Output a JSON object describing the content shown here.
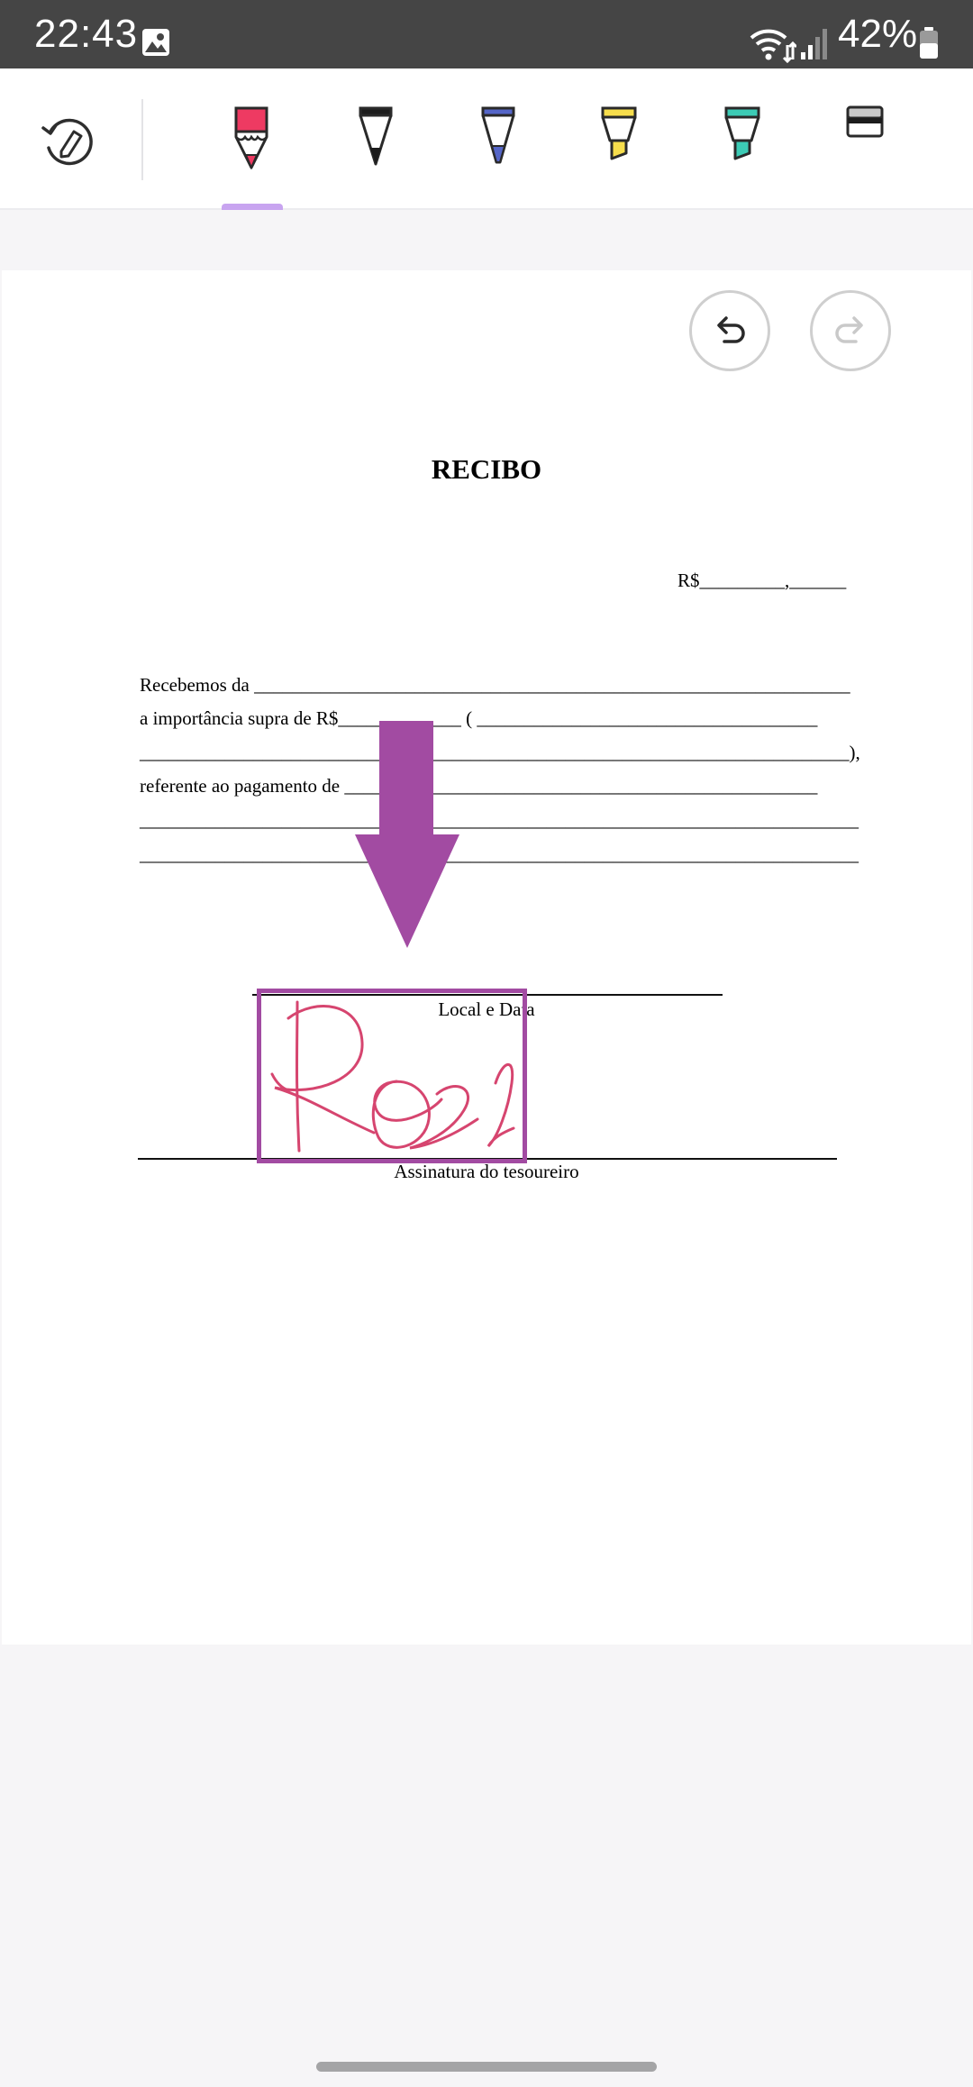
{
  "status_bar": {
    "time": "22:43",
    "battery_percent": "42%",
    "icons": [
      "gallery-icon",
      "wifi-icon",
      "signal-icon",
      "battery-icon"
    ]
  },
  "toolbar": {
    "tools": [
      {
        "name": "history-eraser-icon"
      },
      {
        "name": "pen-red-icon",
        "color": "#ee3a62",
        "selected": true
      },
      {
        "name": "pen-black-icon",
        "color": "#1c1c1c"
      },
      {
        "name": "pen-blue-icon",
        "color": "#5566c8"
      },
      {
        "name": "marker-yellow-icon",
        "color": "#f7de4c"
      },
      {
        "name": "marker-teal-icon",
        "color": "#3ccbb5"
      },
      {
        "name": "eraser-icon",
        "color": "#c9c9c9"
      }
    ],
    "selected_indicator_color": "#c8a4f0"
  },
  "document": {
    "title": "RECIBO",
    "amount_line": "R$_________,______",
    "lines": [
      "Recebemos da _______________________________________________________________",
      "a importância supra de R$_____________ ( ____________________________________",
      "___________________________________________________________________________),",
      "referente ao pagamento de  __________________________________________________",
      "____________________________________________________________________________",
      "____________________________________________________________________________"
    ],
    "local_date_label": "Local e Data",
    "signature_label": "Assinatura do tesoureiro"
  },
  "annotation": {
    "arrow_color": "#a24ba2",
    "box_color": "#a24ba2",
    "signature_ink_color": "#d6456f"
  },
  "page_controls": {
    "undo_icon": "undo-icon",
    "redo_icon": "redo-icon"
  }
}
